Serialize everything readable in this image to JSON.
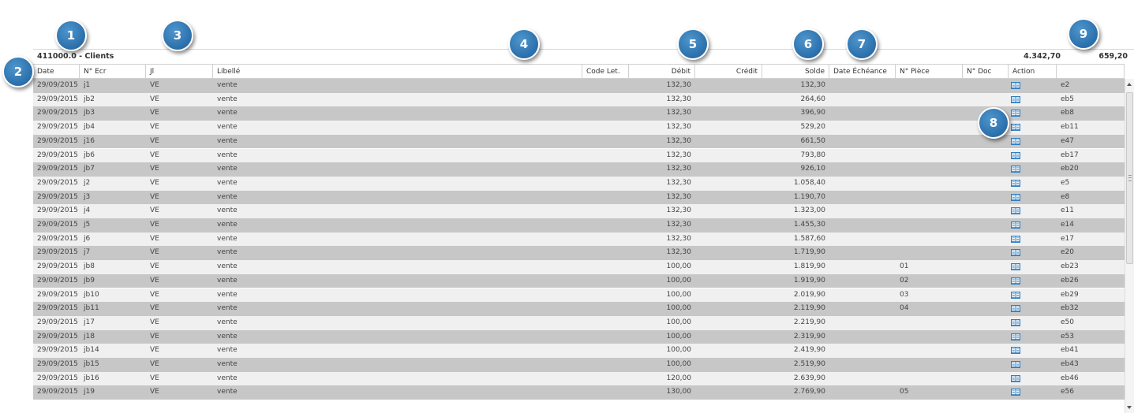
{
  "callouts": [
    "1",
    "2",
    "3",
    "4",
    "5",
    "6",
    "7",
    "8",
    "9"
  ],
  "account": {
    "title": "411000.0 - Clients",
    "debit_total": "4.342,70",
    "credit_total": "659,20"
  },
  "columns": {
    "date": "Date",
    "num_ecr": "N° Ecr",
    "jl": "Jl",
    "libelle": "Libellé",
    "code_let": "Code Let.",
    "debit": "Débit",
    "credit": "Crédit",
    "solde": "Solde",
    "date_echeance": "Date Échéance",
    "num_piece": "N° Pièce",
    "num_doc": "N° Doc",
    "action": "Action",
    "ref": ""
  },
  "icons": {
    "row_action": "open-book-icon",
    "scroll_up": "arrow-up-icon",
    "scroll_down": "arrow-down-icon"
  },
  "colors": {
    "callout": "#2f74b0",
    "row_dark": "#c7c7c7",
    "row_light": "#f0f0f0",
    "icon": "#2f7ec1"
  },
  "rows": [
    {
      "date": "29/09/2015",
      "num_ecr": "j1",
      "jl": "VE",
      "libelle": "vente",
      "code_let": "",
      "debit": "132,30",
      "credit": "",
      "solde": "132,30",
      "date_echeance": "",
      "num_piece": "",
      "num_doc": "",
      "ref": "e2"
    },
    {
      "date": "29/09/2015",
      "num_ecr": "jb2",
      "jl": "VE",
      "libelle": "vente",
      "code_let": "",
      "debit": "132,30",
      "credit": "",
      "solde": "264,60",
      "date_echeance": "",
      "num_piece": "",
      "num_doc": "",
      "ref": "eb5"
    },
    {
      "date": "29/09/2015",
      "num_ecr": "jb3",
      "jl": "VE",
      "libelle": "vente",
      "code_let": "",
      "debit": "132,30",
      "credit": "",
      "solde": "396,90",
      "date_echeance": "",
      "num_piece": "",
      "num_doc": "",
      "ref": "eb8"
    },
    {
      "date": "29/09/2015",
      "num_ecr": "jb4",
      "jl": "VE",
      "libelle": "vente",
      "code_let": "",
      "debit": "132,30",
      "credit": "",
      "solde": "529,20",
      "date_echeance": "",
      "num_piece": "",
      "num_doc": "",
      "ref": "eb11"
    },
    {
      "date": "29/09/2015",
      "num_ecr": "j16",
      "jl": "VE",
      "libelle": "vente",
      "code_let": "",
      "debit": "132,30",
      "credit": "",
      "solde": "661,50",
      "date_echeance": "",
      "num_piece": "",
      "num_doc": "",
      "ref": "e47"
    },
    {
      "date": "29/09/2015",
      "num_ecr": "jb6",
      "jl": "VE",
      "libelle": "vente",
      "code_let": "",
      "debit": "132,30",
      "credit": "",
      "solde": "793,80",
      "date_echeance": "",
      "num_piece": "",
      "num_doc": "",
      "ref": "eb17"
    },
    {
      "date": "29/09/2015",
      "num_ecr": "jb7",
      "jl": "VE",
      "libelle": "vente",
      "code_let": "",
      "debit": "132,30",
      "credit": "",
      "solde": "926,10",
      "date_echeance": "",
      "num_piece": "",
      "num_doc": "",
      "ref": "eb20"
    },
    {
      "date": "29/09/2015",
      "num_ecr": "j2",
      "jl": "VE",
      "libelle": "vente",
      "code_let": "",
      "debit": "132,30",
      "credit": "",
      "solde": "1.058,40",
      "date_echeance": "",
      "num_piece": "",
      "num_doc": "",
      "ref": "e5"
    },
    {
      "date": "29/09/2015",
      "num_ecr": "j3",
      "jl": "VE",
      "libelle": "vente",
      "code_let": "",
      "debit": "132,30",
      "credit": "",
      "solde": "1.190,70",
      "date_echeance": "",
      "num_piece": "",
      "num_doc": "",
      "ref": "e8"
    },
    {
      "date": "29/09/2015",
      "num_ecr": "j4",
      "jl": "VE",
      "libelle": "vente",
      "code_let": "",
      "debit": "132,30",
      "credit": "",
      "solde": "1.323,00",
      "date_echeance": "",
      "num_piece": "",
      "num_doc": "",
      "ref": "e11"
    },
    {
      "date": "29/09/2015",
      "num_ecr": "j5",
      "jl": "VE",
      "libelle": "vente",
      "code_let": "",
      "debit": "132,30",
      "credit": "",
      "solde": "1.455,30",
      "date_echeance": "",
      "num_piece": "",
      "num_doc": "",
      "ref": "e14"
    },
    {
      "date": "29/09/2015",
      "num_ecr": "j6",
      "jl": "VE",
      "libelle": "vente",
      "code_let": "",
      "debit": "132,30",
      "credit": "",
      "solde": "1.587,60",
      "date_echeance": "",
      "num_piece": "",
      "num_doc": "",
      "ref": "e17"
    },
    {
      "date": "29/09/2015",
      "num_ecr": "j7",
      "jl": "VE",
      "libelle": "vente",
      "code_let": "",
      "debit": "132,30",
      "credit": "",
      "solde": "1.719,90",
      "date_echeance": "",
      "num_piece": "",
      "num_doc": "",
      "ref": "e20"
    },
    {
      "date": "29/09/2015",
      "num_ecr": "jb8",
      "jl": "VE",
      "libelle": "vente",
      "code_let": "",
      "debit": "100,00",
      "credit": "",
      "solde": "1.819,90",
      "date_echeance": "",
      "num_piece": "01",
      "num_doc": "",
      "ref": "eb23"
    },
    {
      "date": "29/09/2015",
      "num_ecr": "jb9",
      "jl": "VE",
      "libelle": "vente",
      "code_let": "",
      "debit": "100,00",
      "credit": "",
      "solde": "1.919,90",
      "date_echeance": "",
      "num_piece": "02",
      "num_doc": "",
      "ref": "eb26"
    },
    {
      "date": "29/09/2015",
      "num_ecr": "jb10",
      "jl": "VE",
      "libelle": "vente",
      "code_let": "",
      "debit": "100,00",
      "credit": "",
      "solde": "2.019,90",
      "date_echeance": "",
      "num_piece": "03",
      "num_doc": "",
      "ref": "eb29"
    },
    {
      "date": "29/09/2015",
      "num_ecr": "jb11",
      "jl": "VE",
      "libelle": "vente",
      "code_let": "",
      "debit": "100,00",
      "credit": "",
      "solde": "2.119,90",
      "date_echeance": "",
      "num_piece": "04",
      "num_doc": "",
      "ref": "eb32"
    },
    {
      "date": "29/09/2015",
      "num_ecr": "j17",
      "jl": "VE",
      "libelle": "vente",
      "code_let": "",
      "debit": "100,00",
      "credit": "",
      "solde": "2.219,90",
      "date_echeance": "",
      "num_piece": "",
      "num_doc": "",
      "ref": "e50"
    },
    {
      "date": "29/09/2015",
      "num_ecr": "j18",
      "jl": "VE",
      "libelle": "vente",
      "code_let": "",
      "debit": "100,00",
      "credit": "",
      "solde": "2.319,90",
      "date_echeance": "",
      "num_piece": "",
      "num_doc": "",
      "ref": "e53"
    },
    {
      "date": "29/09/2015",
      "num_ecr": "jb14",
      "jl": "VE",
      "libelle": "vente",
      "code_let": "",
      "debit": "100,00",
      "credit": "",
      "solde": "2.419,90",
      "date_echeance": "",
      "num_piece": "",
      "num_doc": "",
      "ref": "eb41"
    },
    {
      "date": "29/09/2015",
      "num_ecr": "jb15",
      "jl": "VE",
      "libelle": "vente",
      "code_let": "",
      "debit": "100,00",
      "credit": "",
      "solde": "2.519,90",
      "date_echeance": "",
      "num_piece": "",
      "num_doc": "",
      "ref": "eb43"
    },
    {
      "date": "29/09/2015",
      "num_ecr": "jb16",
      "jl": "VE",
      "libelle": "vente",
      "code_let": "",
      "debit": "120,00",
      "credit": "",
      "solde": "2.639,90",
      "date_echeance": "",
      "num_piece": "",
      "num_doc": "",
      "ref": "eb46"
    },
    {
      "date": "29/09/2015",
      "num_ecr": "j19",
      "jl": "VE",
      "libelle": "vente",
      "code_let": "",
      "debit": "130,00",
      "credit": "",
      "solde": "2.769,90",
      "date_echeance": "",
      "num_piece": "05",
      "num_doc": "",
      "ref": "e56"
    }
  ]
}
